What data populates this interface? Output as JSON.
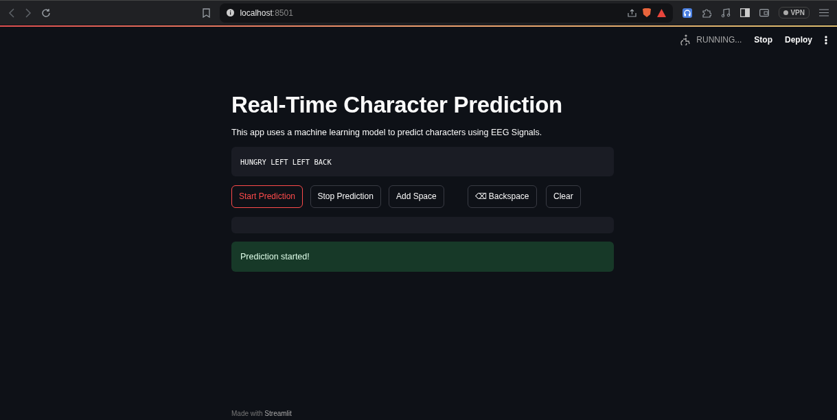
{
  "browser": {
    "address": "**localhost**:8501",
    "vpn_label": "VPN"
  },
  "app_header": {
    "status": "RUNNING...",
    "actions": [
      "Stop",
      "Deploy"
    ]
  },
  "title": "Real-Time Character Prediction",
  "description": "This app uses a machine learning model to predict characters using EEG Signals.",
  "output_code": "HUNGRY LEFT LEFT BACK",
  "buttons": [
    {
      "label": "Start Prediction",
      "focused": true
    },
    {
      "label": "Stop Prediction",
      "focused": false
    },
    {
      "label": "Add Space",
      "focused": false
    },
    {
      "label": "⌫ Backspace",
      "focused": false
    },
    {
      "label": "Clear",
      "focused": false
    }
  ],
  "alert": {
    "kind": "success",
    "text": "Prediction started!"
  },
  "footer": {
    "prefix": "Made with",
    "link": "Streamlit"
  }
}
